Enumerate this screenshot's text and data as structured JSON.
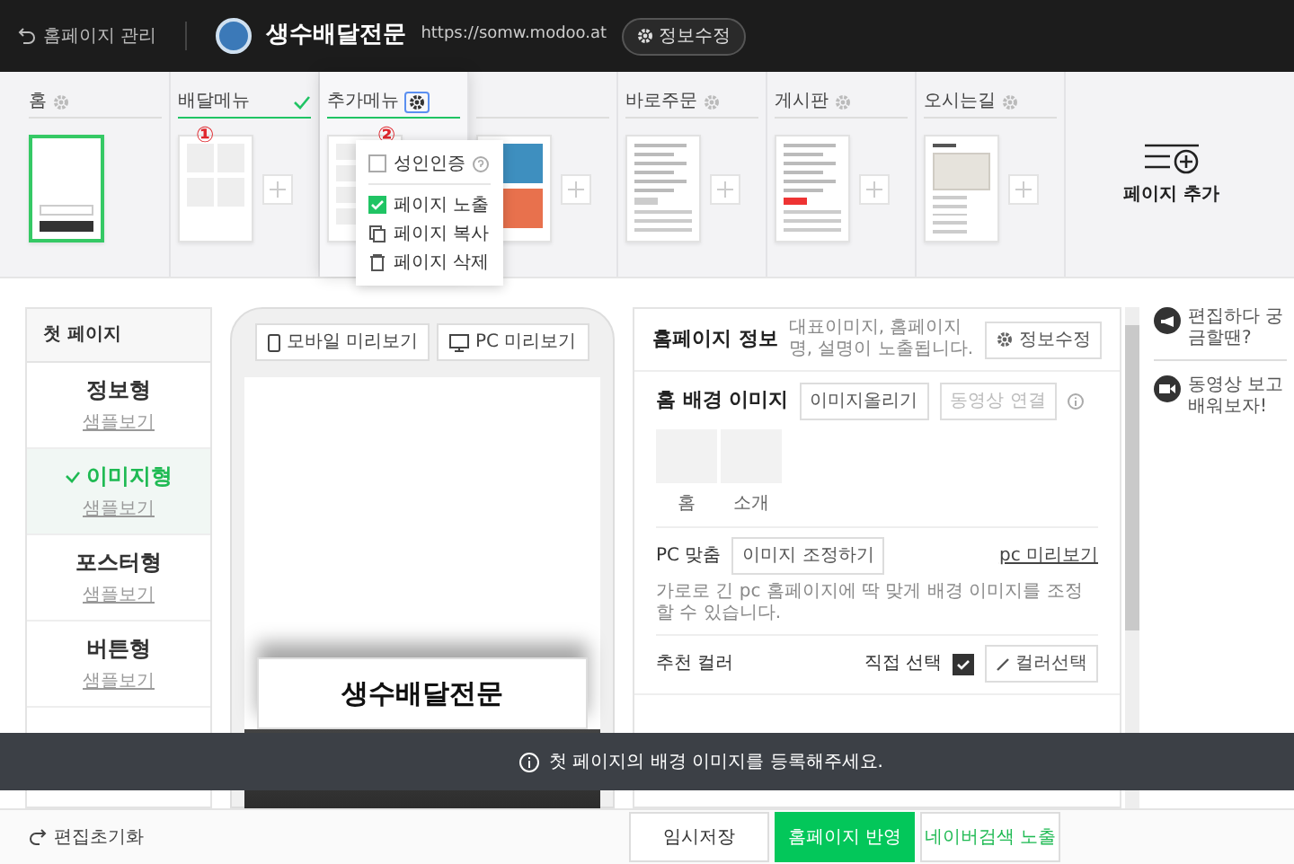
{
  "header": {
    "back_label": "홈페이지 관리",
    "site_name": "생수배달전문",
    "url": "https://somw.modoo.at",
    "edit_button": "정보수정"
  },
  "pages": [
    {
      "title": "홈",
      "settings": true,
      "checked": false,
      "editing": false,
      "selected": true,
      "kind": "home",
      "add": false
    },
    {
      "title": "배달메뉴",
      "settings": false,
      "checked": true,
      "editing": false,
      "selected": false,
      "kind": "grid",
      "add": true,
      "annotation": "①"
    },
    {
      "title": "추가메뉴",
      "settings": true,
      "checked": false,
      "editing": true,
      "selected": false,
      "kind": "list",
      "add": false,
      "annotation": "②"
    },
    {
      "settings": false,
      "checked": false,
      "editing": false,
      "selected": false,
      "kind": "banners",
      "add": true
    },
    {
      "title": "바로주문",
      "settings": true,
      "checked": false,
      "editing": false,
      "selected": false,
      "kind": "order",
      "add": true
    },
    {
      "title": "게시판",
      "settings": true,
      "checked": false,
      "editing": false,
      "selected": false,
      "kind": "board",
      "add": true
    },
    {
      "title": "오시는길",
      "settings": true,
      "checked": false,
      "editing": false,
      "selected": false,
      "kind": "map",
      "add": true
    }
  ],
  "page_menu": [
    {
      "kind": "checkbox",
      "label": "성인인증",
      "checked": false,
      "help": true
    },
    {
      "kind": "checkbox",
      "label": "페이지 노출",
      "checked": true
    },
    {
      "kind": "copy",
      "label": "페이지 복사"
    },
    {
      "kind": "delete",
      "label": "페이지 삭제"
    }
  ],
  "add_page": "페이지 추가",
  "first_page": {
    "title": "첫 페이지",
    "types": [
      {
        "name": "정보형",
        "sample": "샘플보기",
        "selected": false
      },
      {
        "name": "이미지형",
        "sample": "샘플보기",
        "selected": true
      },
      {
        "name": "포스터형",
        "sample": "샘플보기",
        "selected": false
      },
      {
        "name": "버튼형",
        "sample": "샘플보기",
        "selected": false
      }
    ]
  },
  "preview": {
    "buttons": [
      {
        "kind": "mobile",
        "label": "모바일 미리보기"
      },
      {
        "kind": "pc",
        "label": "PC 미리보기"
      }
    ],
    "banner_title": "생수배달전문"
  },
  "info": {
    "title": "홈페이지 정보",
    "description": "대표이미지, 홈페이지명, 설명이 노출됩니다.",
    "edit_button": "정보수정",
    "background": {
      "title": "홈 배경 이미지",
      "buttons": [
        {
          "label": "이미지올리기",
          "disabled": false
        },
        {
          "label": "동영상 연결",
          "disabled": true
        }
      ],
      "images": [
        "홈",
        "소개"
      ]
    },
    "pc_fit": {
      "label": "PC 맞춤",
      "button": "이미지 조정하기",
      "link": "pc 미리보기",
      "description": "가로로 긴 pc 홈페이지에 딱 맞게 배경 이미지를 조정할 수 있습니다."
    },
    "color": {
      "label": "추천 컬러",
      "direct_label": "직접 선택",
      "direct_checked": true,
      "button": "컬러선택"
    }
  },
  "help": [
    {
      "kind": "megaphone",
      "text": "편집하다 궁금할땐?"
    },
    {
      "kind": "video",
      "text": "동영상 보고 배워보자!"
    }
  ],
  "toast": "첫 페이지의 배경 이미지를 등록해주세요.",
  "footer": {
    "reset": "편집초기화",
    "buttons": [
      {
        "kind": "plain",
        "label": "임시저장"
      },
      {
        "kind": "primary",
        "label": "홈페이지 반영"
      },
      {
        "kind": "outline",
        "label": "네이버검색 노출"
      }
    ]
  }
}
